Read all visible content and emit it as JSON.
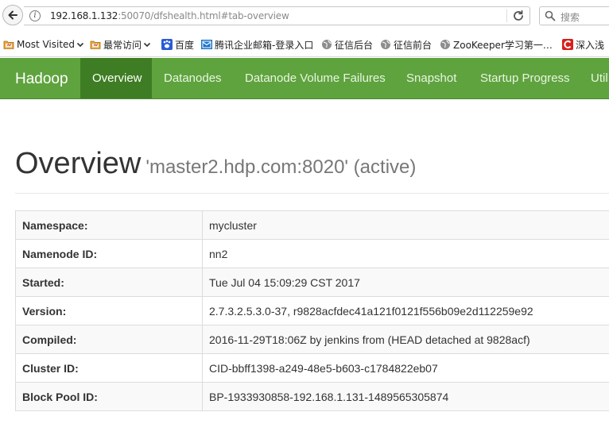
{
  "browser": {
    "url_host": "192.168.1.132",
    "url_rest": ":50070/dfshealth.html#tab-overview",
    "search_placeholder": "搜索",
    "bookmarks": [
      {
        "label": "Most Visited",
        "icon": "folder-icon",
        "dropdown": true
      },
      {
        "label": "最常访问",
        "icon": "folder-icon",
        "dropdown": true
      },
      {
        "label": "百度",
        "icon": "baidu-paw-icon",
        "dropdown": false
      },
      {
        "label": "腾讯企业邮箱-登录入口",
        "icon": "mail-icon",
        "dropdown": false
      },
      {
        "label": "征信后台",
        "icon": "globe-icon",
        "dropdown": false
      },
      {
        "label": "征信前台",
        "icon": "globe-icon",
        "dropdown": false
      },
      {
        "label": "ZooKeeper学习第一…",
        "icon": "globe-icon",
        "dropdown": false
      },
      {
        "label": "深入浅",
        "icon": "csdn-icon",
        "dropdown": false
      }
    ]
  },
  "navbar": {
    "brand": "Hadoop",
    "color": "#5fa33e",
    "active_color": "#3e7d23",
    "items": [
      {
        "label": "Overview",
        "active": true
      },
      {
        "label": "Datanodes",
        "active": false
      },
      {
        "label": "Datanode Volume Failures",
        "active": false
      },
      {
        "label": "Snapshot",
        "active": false
      },
      {
        "label": "Startup Progress",
        "active": false
      },
      {
        "label": "Util",
        "active": false
      }
    ]
  },
  "page": {
    "title": "Overview",
    "subtitle": "'master2.hdp.com:8020' (active)"
  },
  "overview_table": [
    {
      "key": "Namespace:",
      "value": "mycluster"
    },
    {
      "key": "Namenode ID:",
      "value": "nn2"
    },
    {
      "key": "Started:",
      "value": "Tue Jul 04 15:09:29 CST 2017"
    },
    {
      "key": "Version:",
      "value": "2.7.3.2.5.3.0-37, r9828acfdec41a121f0121f556b09e2d112259e92"
    },
    {
      "key": "Compiled:",
      "value": "2016-11-29T18:06Z by jenkins from (HEAD detached at 9828acf)"
    },
    {
      "key": "Cluster ID:",
      "value": "CID-bbff1398-a249-48e5-b603-c1784822eb07"
    },
    {
      "key": "Block Pool ID:",
      "value": "BP-1933930858-192.168.1.131-1489565305874"
    }
  ]
}
